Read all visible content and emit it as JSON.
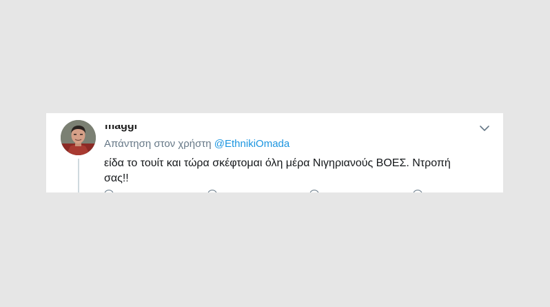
{
  "tweet": {
    "username": "maggi",
    "reply_prefix": "Απάντηση στον χρήστη",
    "reply_handle": "@EthnikiOmada",
    "text": "είδα το τουίτ και τώρα σκέφτομαι όλη μέρα Νιγηριανούς ΒΟΕΣ. Ντροπή σας!!"
  },
  "icons": {
    "menu": "chevron-down-icon",
    "actions": [
      "reply-icon",
      "retweet-icon",
      "like-icon",
      "share-icon"
    ]
  },
  "colors": {
    "background": "#e6e6e6",
    "card": "#ffffff",
    "link": "#1b95e0",
    "secondary_text": "#657786",
    "primary_text": "#14171a"
  }
}
